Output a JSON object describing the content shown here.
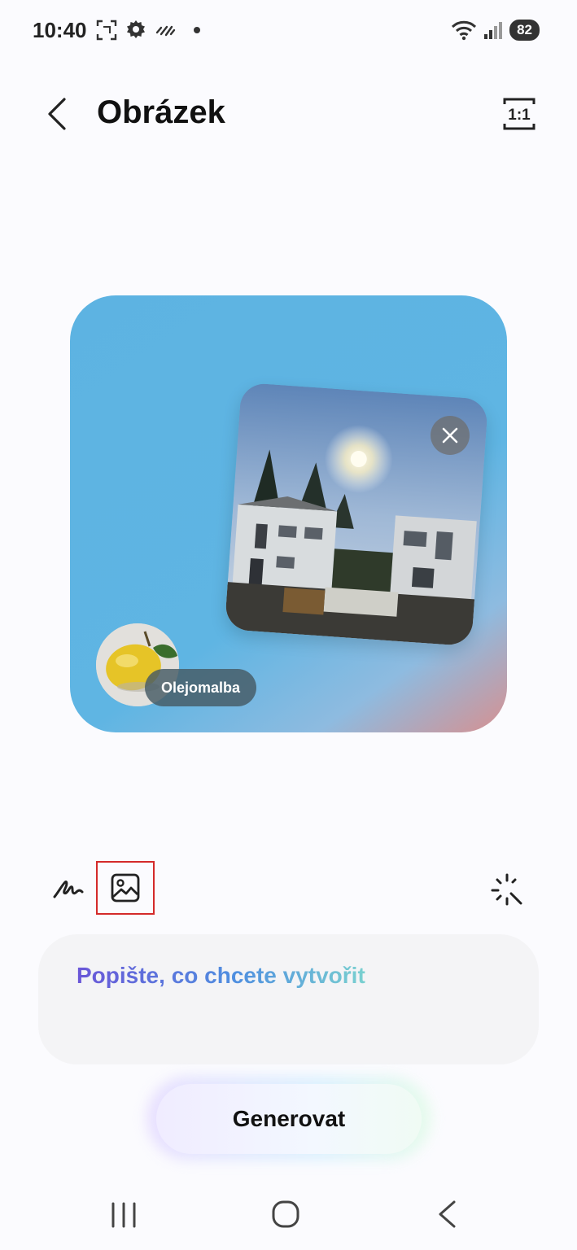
{
  "status_bar": {
    "time": "10:40",
    "battery": "82",
    "left_icons": [
      "screenshot-icon",
      "gear-icon",
      "data-saver-icon",
      "notification-dot"
    ],
    "right_icons": [
      "wifi-icon",
      "signal-icon",
      "battery-icon"
    ]
  },
  "header": {
    "title": "Obrázek",
    "back_icon": "chevron-left-icon",
    "ratio_label": "1:1"
  },
  "card": {
    "style_label": "Olejomalba",
    "close_icon": "close-icon",
    "colors": {
      "gradient_main": "#5db3e2",
      "gradient_corner": "#d79090"
    }
  },
  "tools": {
    "draw_icon": "handwriting-icon",
    "image_icon": "image-icon",
    "sparkle_icon": "sparkle-icon"
  },
  "prompt": {
    "placeholder": "Popište, co chcete vytvořit"
  },
  "generate": {
    "label": "Generovat"
  },
  "nav_bar": {
    "items": [
      "recent-apps-icon",
      "home-icon",
      "back-icon"
    ]
  }
}
